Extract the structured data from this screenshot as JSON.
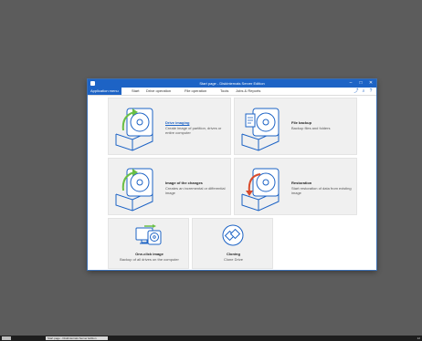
{
  "window": {
    "title": "Start page - DiskInternals Server Edition",
    "controls": {
      "minimize": "–",
      "maximize": "□",
      "close": "✕"
    }
  },
  "menubar": {
    "app_menu": "Application menu",
    "items": [
      "Start",
      "Drive operation",
      "File operation",
      "Tools",
      "Jobs & Reports"
    ],
    "right_icons": [
      "share-icon",
      "search-icon",
      "help-icon"
    ]
  },
  "tiles": [
    {
      "title": "Drive imaging",
      "desc": "Create image of partition, drives or entire computer",
      "icon": "drive-imaging-icon"
    },
    {
      "title": "File backup",
      "desc": "Backup files and folders",
      "icon": "file-backup-icon"
    },
    {
      "title": "Image of the changes",
      "desc": "Creates an incremental or differential image",
      "icon": "incremental-image-icon"
    },
    {
      "title": "Restoration",
      "desc": "Start restoration of data from existing image",
      "icon": "restoration-icon"
    },
    {
      "title": "One-click image",
      "desc": "Backup of all drives on the computer",
      "icon": "one-click-image-icon"
    },
    {
      "title": "Cloning",
      "desc": "Clone Drive",
      "icon": "cloning-icon"
    }
  ],
  "colors": {
    "accent": "#1d63c5",
    "tile_bg": "#f0f0f0",
    "green_arrow": "#6abf45",
    "red_arrow": "#d94b2b"
  },
  "taskbar": {
    "task_label": "Start page - DiskInternals Server Edition",
    "clock": "12"
  }
}
